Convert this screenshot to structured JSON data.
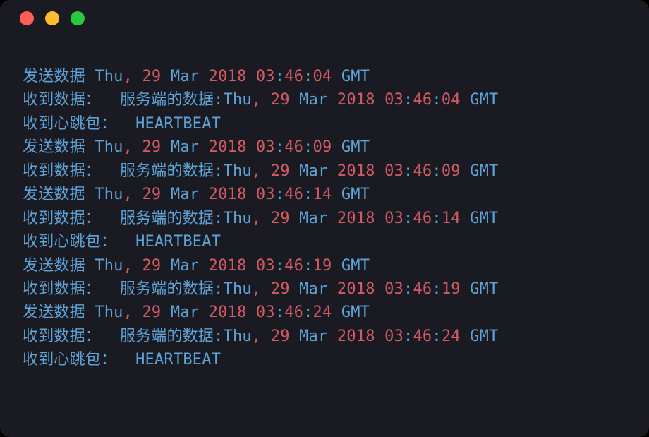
{
  "strings": {
    "sendPrefix": "发送数据 ",
    "recvPrefix": "收到数据：  服务端的数据:",
    "heartbeat": "收到心跳包：  HEARTBEAT",
    "day": "Thu",
    "dayNum": "29",
    "month": "Mar",
    "year": "2018",
    "gmt": "GMT",
    "colon": ":",
    "comma": ", "
  },
  "events": [
    {
      "type": "send",
      "hh": "03",
      "mm": "46",
      "ss": "04"
    },
    {
      "type": "recv",
      "hh": "03",
      "mm": "46",
      "ss": "04"
    },
    {
      "type": "hb"
    },
    {
      "type": "send",
      "hh": "03",
      "mm": "46",
      "ss": "09"
    },
    {
      "type": "recv",
      "hh": "03",
      "mm": "46",
      "ss": "09"
    },
    {
      "type": "send",
      "hh": "03",
      "mm": "46",
      "ss": "14"
    },
    {
      "type": "recv",
      "hh": "03",
      "mm": "46",
      "ss": "14"
    },
    {
      "type": "hb"
    },
    {
      "type": "send",
      "hh": "03",
      "mm": "46",
      "ss": "19"
    },
    {
      "type": "recv",
      "hh": "03",
      "mm": "46",
      "ss": "19"
    },
    {
      "type": "send",
      "hh": "03",
      "mm": "46",
      "ss": "24"
    },
    {
      "type": "recv",
      "hh": "03",
      "mm": "46",
      "ss": "24"
    },
    {
      "type": "hb"
    }
  ]
}
